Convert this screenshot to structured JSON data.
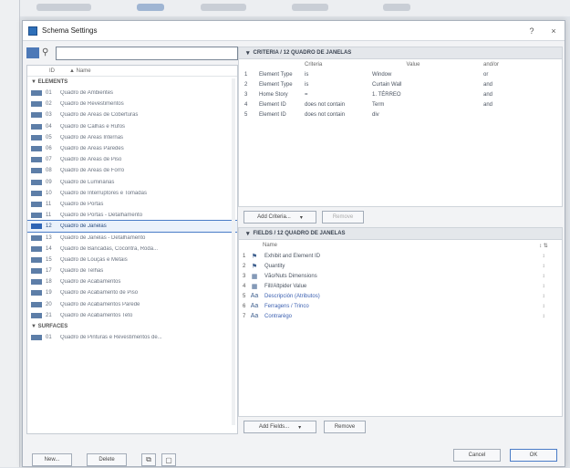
{
  "window": {
    "title": "Schema Settings",
    "help": "?",
    "close": "×"
  },
  "search": {
    "placeholder": ""
  },
  "list": {
    "headers": {
      "id": "ID",
      "name": "▲ Name"
    },
    "groups": {
      "elements": "▼ ELEMENTS",
      "surfaces": "▼ SURFACES"
    },
    "elements": [
      {
        "id": "01",
        "name": "Quadro de Ambientes"
      },
      {
        "id": "02",
        "name": "Quadro de Revestimentos"
      },
      {
        "id": "03",
        "name": "Quadro de Áreas de Coberturas"
      },
      {
        "id": "04",
        "name": "Quadro de Calhas e Rufos"
      },
      {
        "id": "05",
        "name": "Quadro de Áreas Internas"
      },
      {
        "id": "06",
        "name": "Quadro de Áreas Paredes"
      },
      {
        "id": "07",
        "name": "Quadro de Áreas de Piso"
      },
      {
        "id": "08",
        "name": "Quadro de Áreas de Forro"
      },
      {
        "id": "09",
        "name": "Quadro de Luminárias"
      },
      {
        "id": "10",
        "name": "Quadro de Interruptores e Tomadas"
      },
      {
        "id": "11",
        "name": "Quadro de Portas"
      },
      {
        "id": "11",
        "name": "Quadro de Portas - Detalhamento"
      },
      {
        "id": "12",
        "name": "Quadro de Janelas"
      },
      {
        "id": "13",
        "name": "Quadro de Janelas - Detalhamento"
      },
      {
        "id": "14",
        "name": "Quadro de Bancadas, Cocontra, Roda..."
      },
      {
        "id": "15",
        "name": "Quadro de Louças e Metais"
      },
      {
        "id": "17",
        "name": "Quadro de Telhas"
      },
      {
        "id": "18",
        "name": "Quadro de Acabamentos"
      },
      {
        "id": "19",
        "name": "Quadro de Acabamento de Piso"
      },
      {
        "id": "20",
        "name": "Quadro de Acabamentos Parede"
      },
      {
        "id": "21",
        "name": "Quadro de Acabamentos Teto"
      }
    ],
    "surfaces": [
      {
        "id": "01",
        "name": "Quadro de Pinturas e Revestimentos de..."
      }
    ]
  },
  "left_buttons": {
    "new": "New...",
    "delete": "Delete"
  },
  "criteria": {
    "title": "CRITERIA / 12 QUADRO DE JANELAS",
    "headers": {
      "criteria": "Criteria",
      "value": "Value",
      "andor": "and/or"
    },
    "rows": [
      {
        "n": "1",
        "prop": "Element Type",
        "op": "is",
        "val": "Window",
        "andor": "or"
      },
      {
        "n": "2",
        "prop": "Element Type",
        "op": "is",
        "val": "Curtain Wall",
        "andor": "and"
      },
      {
        "n": "3",
        "prop": "Home Story",
        "op": "=",
        "val": "1. TÉRREO",
        "andor": "and"
      },
      {
        "n": "4",
        "prop": "Element ID",
        "op": "does not contain",
        "val": "Term",
        "andor": "and"
      },
      {
        "n": "5",
        "prop": "Element ID",
        "op": "does not contain",
        "val": "div",
        "andor": ""
      }
    ],
    "add_label": "Add Criteria...",
    "remove_label": "Remove"
  },
  "fields": {
    "title": "FIELDS / 12 QUADRO DE JANELAS",
    "name_header": "Name",
    "rows": [
      {
        "n": "1",
        "name": "Exhibit and Element ID",
        "blue": false
      },
      {
        "n": "2",
        "name": "Quantity",
        "blue": false
      },
      {
        "n": "3",
        "name": "Vão/Nuts Dimensions",
        "blue": false
      },
      {
        "n": "4",
        "name": "Fill/Altpider Value",
        "blue": false
      },
      {
        "n": "5",
        "name": "Descripción (Atributos)",
        "blue": true
      },
      {
        "n": "6",
        "name": "Ferragens / Trinco",
        "blue": true
      },
      {
        "n": "7",
        "name": "Contrarègo",
        "blue": true
      }
    ],
    "add_label": "Add Fields...",
    "remove_label": "Remove"
  },
  "dialog_buttons": {
    "cancel": "Cancel",
    "ok": "OK"
  }
}
